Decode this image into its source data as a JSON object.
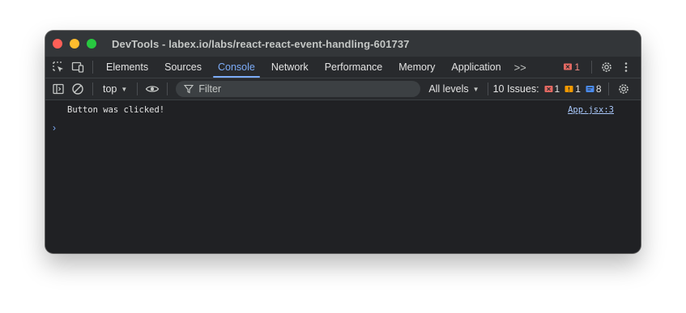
{
  "window": {
    "title": "DevTools - labex.io/labs/react-react-event-handling-601737"
  },
  "tabs": [
    {
      "label": "Elements"
    },
    {
      "label": "Sources"
    },
    {
      "label": "Console"
    },
    {
      "label": "Network"
    },
    {
      "label": "Performance"
    },
    {
      "label": "Memory"
    },
    {
      "label": "Application"
    }
  ],
  "active_tab": "Console",
  "more_tabs_glyph": ">>",
  "error_count": "1",
  "toolbar": {
    "context": "top",
    "filter_placeholder": "Filter",
    "levels": "All levels",
    "issues_label": "10 Issues:",
    "issues_errors": "1",
    "issues_warnings": "1",
    "issues_info": "8"
  },
  "console": {
    "messages": [
      {
        "text": "Button was clicked!",
        "source": "App.jsx:3"
      }
    ],
    "prompt_glyph": "›"
  },
  "colors": {
    "accent": "#7cacf8",
    "error": "#f28b82",
    "warning": "#fdd663",
    "info": "#8ab4f8",
    "background": "#202124"
  }
}
